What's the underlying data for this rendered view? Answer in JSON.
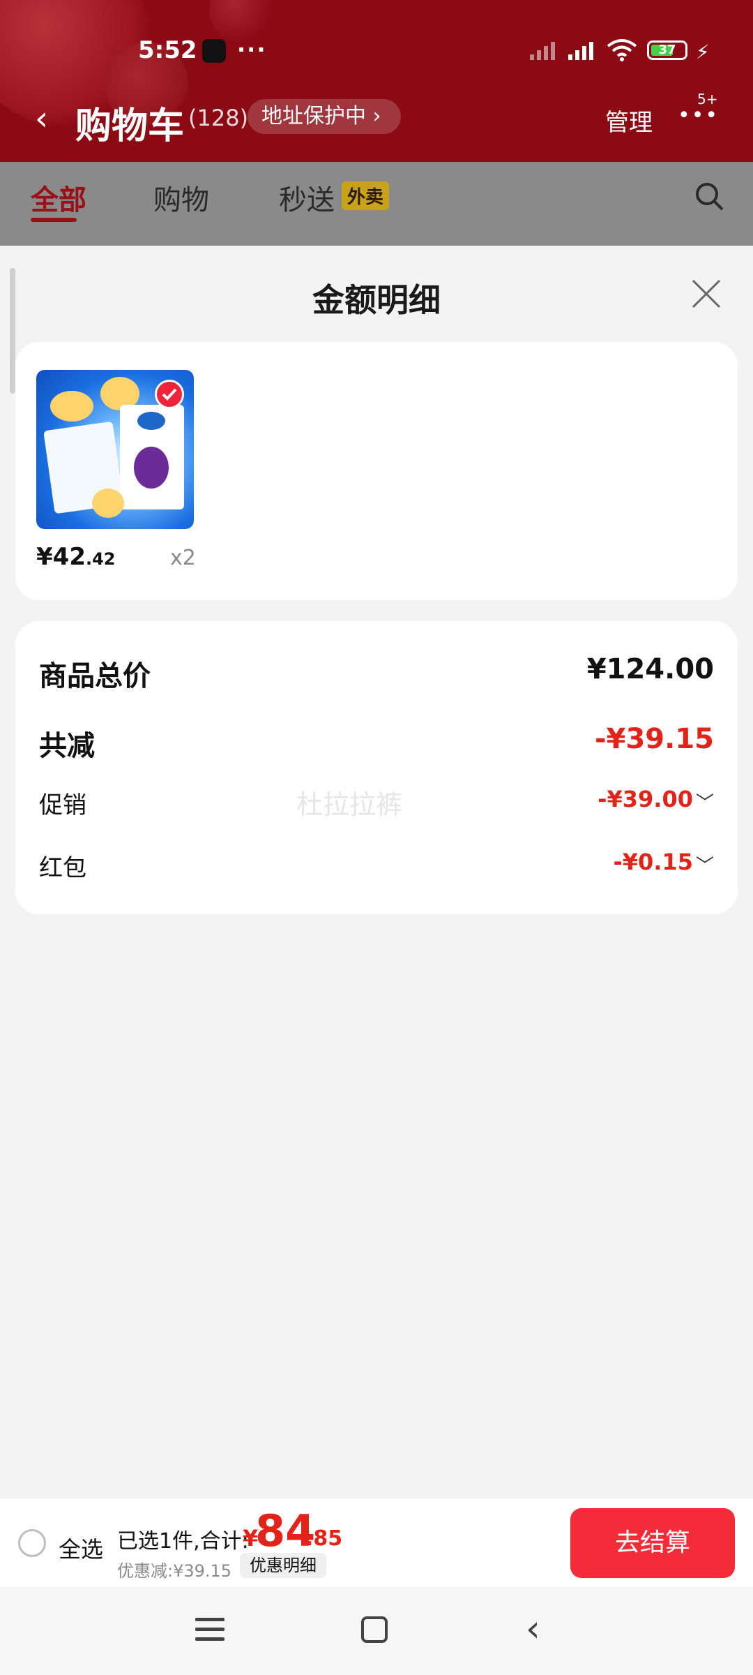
{
  "status": {
    "time": "5:52",
    "dots": "···",
    "battery": "37"
  },
  "header": {
    "back_glyph": "‹",
    "title": "购物车",
    "count": "(128)",
    "address_protect": "地址保护中 ›",
    "manage": "管理",
    "more_badge": "5+"
  },
  "tabs": [
    {
      "label": "全部"
    },
    {
      "label": "购物"
    },
    {
      "label": "秒送"
    }
  ],
  "tab_badge": "外卖",
  "sheet": {
    "title": "金额明细",
    "product": {
      "price_main": "¥42",
      "price_small": ".42",
      "qty": "x2"
    },
    "summary": {
      "total_label": "商品总价",
      "total_value": "¥124.00",
      "discount_label": "共减",
      "discount_value": "-¥39.15",
      "promo_label": "促销",
      "promo_value": "-¥39.00",
      "redpack_label": "红包",
      "redpack_value": "-¥0.15",
      "watermark": "杜拉拉裤"
    }
  },
  "bottom": {
    "select_all": "全选",
    "selected_text": "已选1件,合计:",
    "currency": "¥",
    "total_big": "84",
    "total_small": ".85",
    "saved": "优惠减:¥39.15",
    "detail": "优惠明细",
    "checkout": "去结算"
  },
  "colors": {
    "brand_red": "#f42c39",
    "price_red": "#e2231a"
  }
}
